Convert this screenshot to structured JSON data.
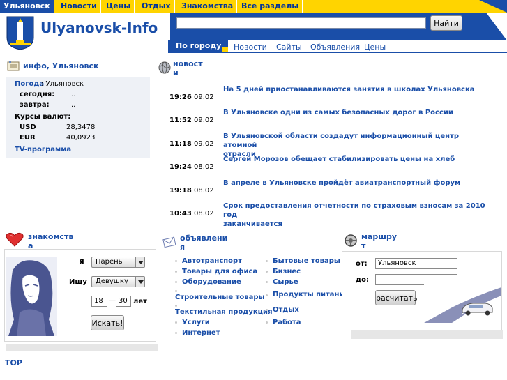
{
  "topnav": {
    "items": [
      "Ульяновск",
      "Новости",
      "Цены",
      "Отдых",
      "Знакомства",
      "Все разделы"
    ]
  },
  "header": {
    "logo_text": "Ulyanovsk-Info",
    "search_placeholder": "",
    "search_button": "Найти"
  },
  "subnav": {
    "active": "По городу",
    "items": [
      "Новости",
      "Сайты",
      "Объявления",
      "Цены"
    ]
  },
  "info": {
    "heading": "инфо, Ульяновск",
    "weather_label": "Погода",
    "weather_city": ": Ульяновск",
    "today_label": "сегодня:",
    "today_value": "..",
    "tomorrow_label": "завтра:",
    "tomorrow_value": "..",
    "rates_label": "Курсы валют:",
    "usd_label": "USD",
    "usd_value": "28,3478",
    "eur_label": "EUR",
    "eur_value": "40,0923",
    "tv_link": "TV-программа"
  },
  "news": {
    "heading_line1": "новост",
    "heading_line2": "и",
    "items": [
      {
        "time": "19:26",
        "date": "09.02",
        "title": "На 5 дней приостанавливаются занятия в школах Ульяновска"
      },
      {
        "time": "11:52",
        "date": "09.02",
        "title": "В Ульяновске одни из самых безопасных дорог в России"
      },
      {
        "time": "11:18",
        "date": "09.02",
        "title_line1": "В Ульяновской области создадут информационный центр атомной",
        "title_line2": "отрасли"
      },
      {
        "time": "19:24",
        "date": "08.02",
        "title": "Сергей Морозов обещает стабилизировать цены на хлеб"
      },
      {
        "time": "19:18",
        "date": "08.02",
        "title": "В апреле в Ульяновске пройдёт авиатранспортный форум"
      },
      {
        "time": "10:43",
        "date": "08.02",
        "title_line1": "Срок предоставления отчетности по страховым взносам за 2010 год",
        "title_line2": "заканчивается"
      }
    ]
  },
  "dating": {
    "heading_line1": "знакомств",
    "heading_line2": "а",
    "i_label": "Я",
    "i_value": "Парень",
    "seek_label": "Ищу",
    "seek_value": "Девушку",
    "age_from": "18",
    "age_dash": "—",
    "age_to": "30",
    "age_unit": "лет",
    "search_button": "Искать!"
  },
  "ads": {
    "heading_line1": "объявлени",
    "heading_line2": "я",
    "col1": [
      "Автотранспорт",
      "Товары для офиса",
      "Оборудование",
      "Строительные товары",
      "Текстильная продукция",
      "Услуги",
      "Интернет"
    ],
    "col2": [
      "Бытовые товары",
      "Бизнес",
      "Сырье",
      "Продукты питания",
      "Отдых",
      "Работа"
    ]
  },
  "route": {
    "heading_line1": "маршру",
    "heading_line2": "т",
    "from_label": "от:",
    "from_value": "Ульяновск",
    "to_label": "до:",
    "to_value": "",
    "calc_button": "расчитать"
  },
  "footer": {
    "top_label": "TOP"
  },
  "colors": {
    "brand_blue": "#1a4ea8",
    "nav_yellow": "#ffd400",
    "info_bg": "#eef1f6"
  }
}
